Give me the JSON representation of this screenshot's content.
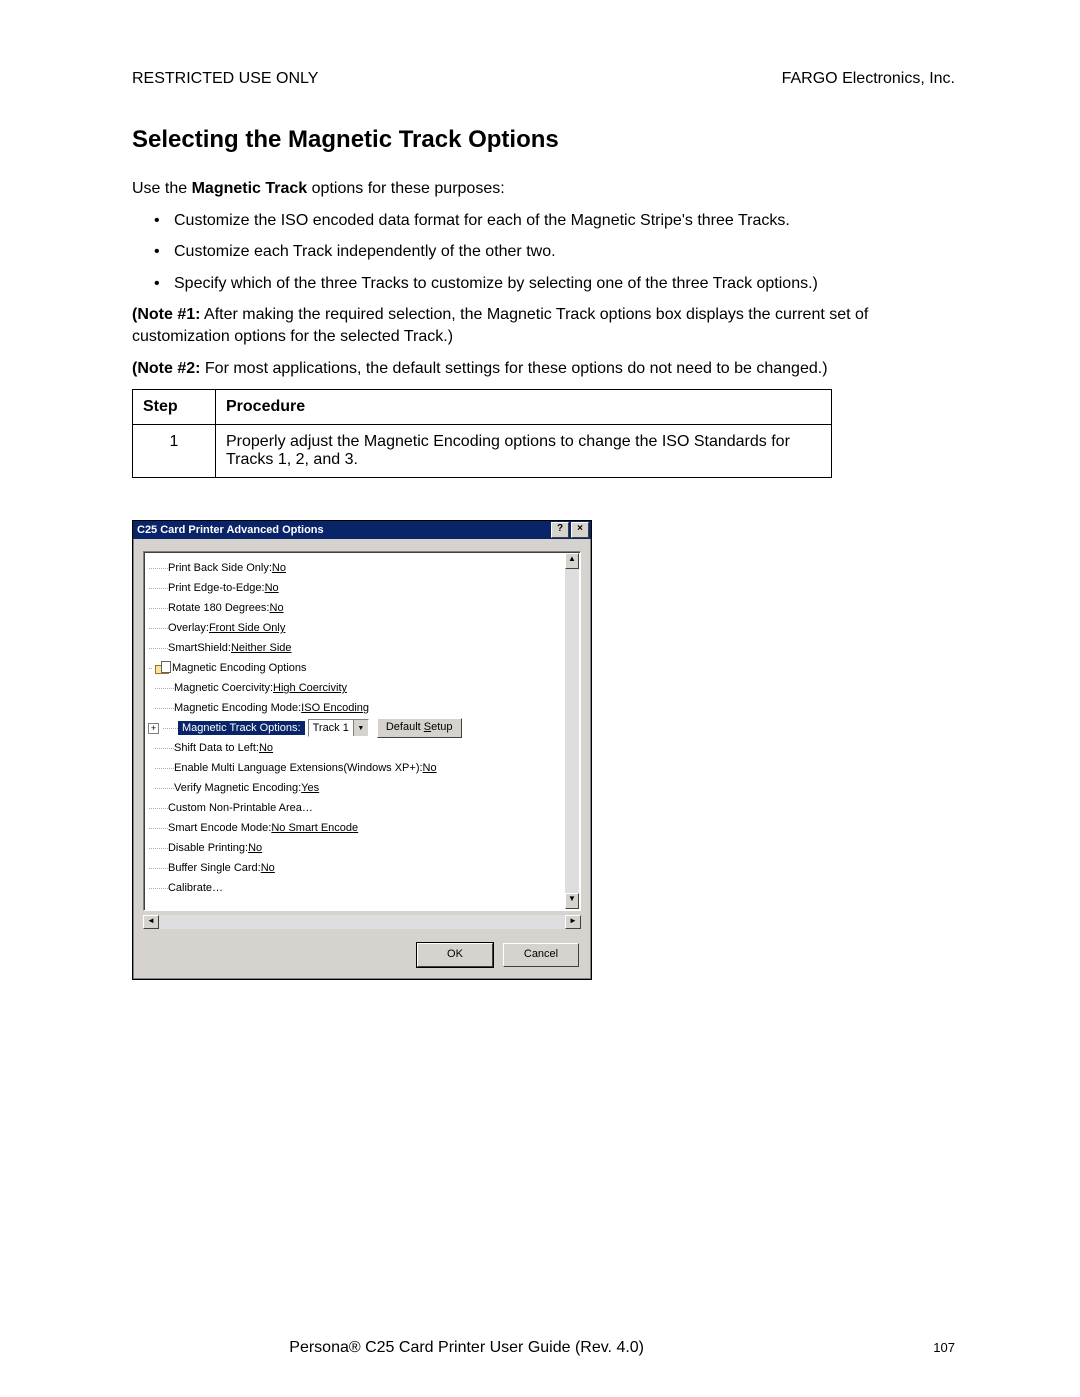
{
  "header": {
    "left": "RESTRICTED USE ONLY",
    "right": "FARGO Electronics, Inc."
  },
  "title": "Selecting the Magnetic Track Options",
  "intro_a": "Use the ",
  "intro_bold": "Magnetic Track",
  "intro_b": " options for these purposes:",
  "bullets": [
    "Customize the ISO encoded data format for each of the Magnetic Stripe's three Tracks.",
    "Customize each Track independently of the other two.",
    "Specify which of the three Tracks to customize by selecting one of the three Track options.)"
  ],
  "note1_label": "(Note #1:",
  "note1_body": "  After making the required selection, the Magnetic Track options box displays the current set of customization options for the selected Track.)",
  "note2_label": "(Note #2:",
  "note2_body": "  For most applications, the default settings for these options do not need to be changed.)",
  "table": {
    "h_step": "Step",
    "h_proc": "Procedure",
    "rows": [
      {
        "step": "1",
        "proc": "Properly adjust the Magnetic Encoding options to change the ISO Standards for Tracks 1, 2, and 3."
      }
    ]
  },
  "dialog": {
    "title": "C25 Card Printer Advanced Options",
    "help_btn": "?",
    "close_btn": "×",
    "scroll_up": "▲",
    "scroll_down": "▼",
    "scroll_left": "◄",
    "scroll_right": "►",
    "tree": {
      "plus": "+",
      "items": [
        {
          "indent": 1,
          "label": "Print Back Side Only: ",
          "val": "No"
        },
        {
          "indent": 1,
          "label": "Print Edge-to-Edge: ",
          "val": "No"
        },
        {
          "indent": 1,
          "label": "Rotate 180 Degrees: ",
          "val": "No"
        },
        {
          "indent": 1,
          "label": "Overlay: ",
          "val": "Front Side Only"
        },
        {
          "indent": 1,
          "label": "SmartShield: ",
          "val": "Neither Side"
        }
      ],
      "folder_label": "Magnetic Encoding Options",
      "sub": [
        {
          "label": "Magnetic Coercivity: ",
          "val": "High Coercivity"
        },
        {
          "label": "Magnetic Encoding Mode: ",
          "val": "ISO Encoding"
        }
      ],
      "selected_label": "Magnetic Track Options:",
      "combo_value": "Track 1",
      "default_setup_a": "Default ",
      "default_setup_u": "S",
      "default_setup_b": "etup",
      "sub2": [
        {
          "label": "Shift Data to Left: ",
          "val": "No"
        },
        {
          "label": "Enable Multi Language Extensions(Windows XP+): ",
          "val": "No"
        },
        {
          "label": "Verify Magnetic Encoding: ",
          "val": "Yes"
        }
      ],
      "tail": [
        {
          "label": "Custom Non-Printable Area…",
          "val": ""
        },
        {
          "label": "Smart Encode Mode: ",
          "val": "No Smart Encode"
        },
        {
          "label": "Disable Printing: ",
          "val": "No"
        },
        {
          "label": "Buffer Single Card: ",
          "val": "No"
        },
        {
          "label": "Calibrate…",
          "val": ""
        }
      ]
    },
    "ok": "OK",
    "cancel": "Cancel"
  },
  "footer": {
    "text": "Persona® C25 Card Printer User Guide (Rev. 4.0)",
    "page": "107"
  }
}
